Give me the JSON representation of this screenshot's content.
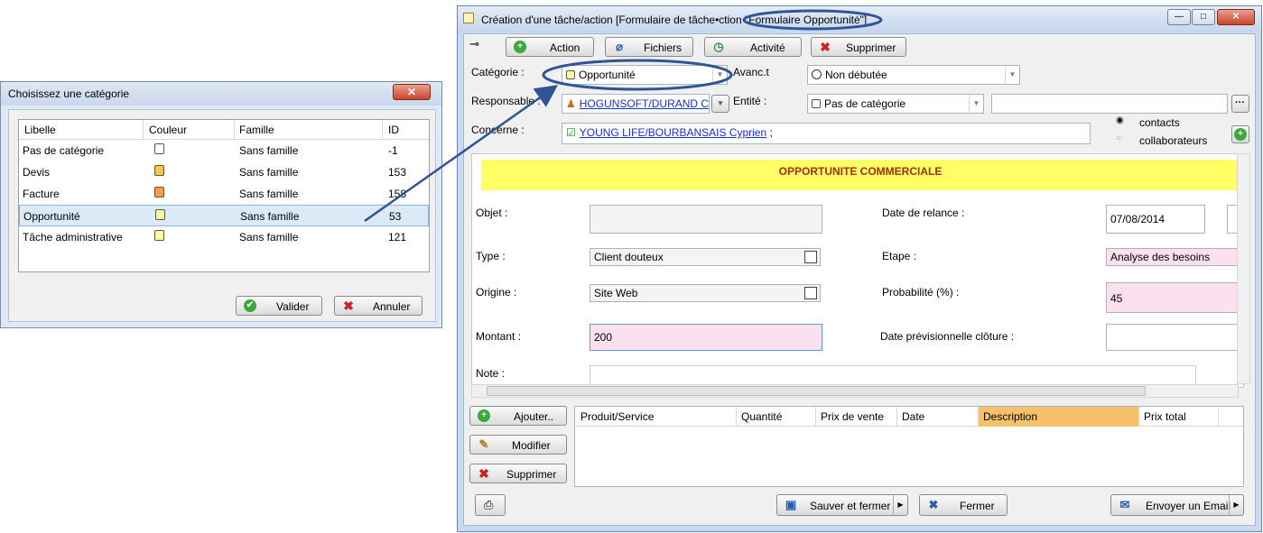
{
  "category_dialog": {
    "title": "Choisissez une catégorie",
    "close_label": "✕",
    "columns": [
      "Libelle",
      "Couleur",
      "Famille",
      "ID"
    ],
    "rows": [
      {
        "libelle": "Pas de catégorie",
        "couleur": "#ffffff",
        "famille": "Sans famille",
        "id": "-1"
      },
      {
        "libelle": "Devis",
        "couleur": "#f5c842",
        "famille": "Sans famille",
        "id": "153"
      },
      {
        "libelle": "Facture",
        "couleur": "#f0a040",
        "famille": "Sans famille",
        "id": "158"
      },
      {
        "libelle": "Opportunité",
        "couleur": "#fffaa0",
        "famille": "Sans famille",
        "id": "53",
        "selected": true
      },
      {
        "libelle": "Tâche administrative",
        "couleur": "#fffaa0",
        "famille": "Sans famille",
        "id": "121"
      }
    ],
    "ok_label": "Valider",
    "cancel_label": "Annuler"
  },
  "main_window": {
    "title": "Création d'une tâche/action [Formulaire de tâche•ction \"Formulaire Opportunité\"]",
    "min_label": "—",
    "max_label": "□",
    "close_label": "✕",
    "toolbar": {
      "action_label": "Action",
      "files_label": "Fichiers",
      "activity_label": "Activité",
      "delete_label": "Supprimer"
    },
    "header": {
      "category_label": "Catégorie :",
      "category_value": "Opportunité",
      "progress_label": "Avanc.t",
      "progress_value": "Non débutée",
      "owner_label": "Responsable :",
      "owner_value": "HOGUNSOFT/DURAND Cathe",
      "entity_label": "Entité :",
      "entity_value": "Pas de catégorie",
      "entity_extra_value": "",
      "more_label": "···",
      "concerns_label": "Concerne :",
      "concerns_value": "YOUNG LIFE/BOURBANSAIS Cyprien",
      "concerns_suffix": " ;",
      "radio_contacts": "contacts",
      "radio_collab": "collaborateurs"
    },
    "form": {
      "banner": "OPPORTUNITE COMMERCIALE",
      "object_label": "Objet :",
      "object_value": "",
      "relance_label": "Date de relance :",
      "relance_value": "07/08/2014",
      "type_label": "Type :",
      "type_value": "Client douteux",
      "step_label": "Etape :",
      "step_value": "Analyse des besoins",
      "origin_label": "Origine :",
      "origin_value": "Site Web",
      "prob_label": "Probabilité (%) :",
      "prob_value": "45",
      "amount_label": "Montant :",
      "amount_value": "200",
      "close_date_label": "Date prévisionnelle clôture :",
      "close_date_value": "",
      "note_label": "Note :"
    },
    "products": {
      "add_label": "Ajouter..",
      "edit_label": "Modifier",
      "delete_label": "Supprimer",
      "columns": [
        "Produit/Service",
        "Quantité",
        "Prix de vente",
        "Date",
        "Description",
        "Prix total"
      ]
    },
    "footer": {
      "save_close_label": "Sauver et fermer",
      "close_label": "Fermer",
      "email_label": "Envoyer un Email"
    }
  },
  "colors": {
    "highlight_outline": "#2f5597",
    "banner_bg": "#ffff66",
    "banner_text": "#a0320a",
    "required_bg": "#fde0ee"
  }
}
